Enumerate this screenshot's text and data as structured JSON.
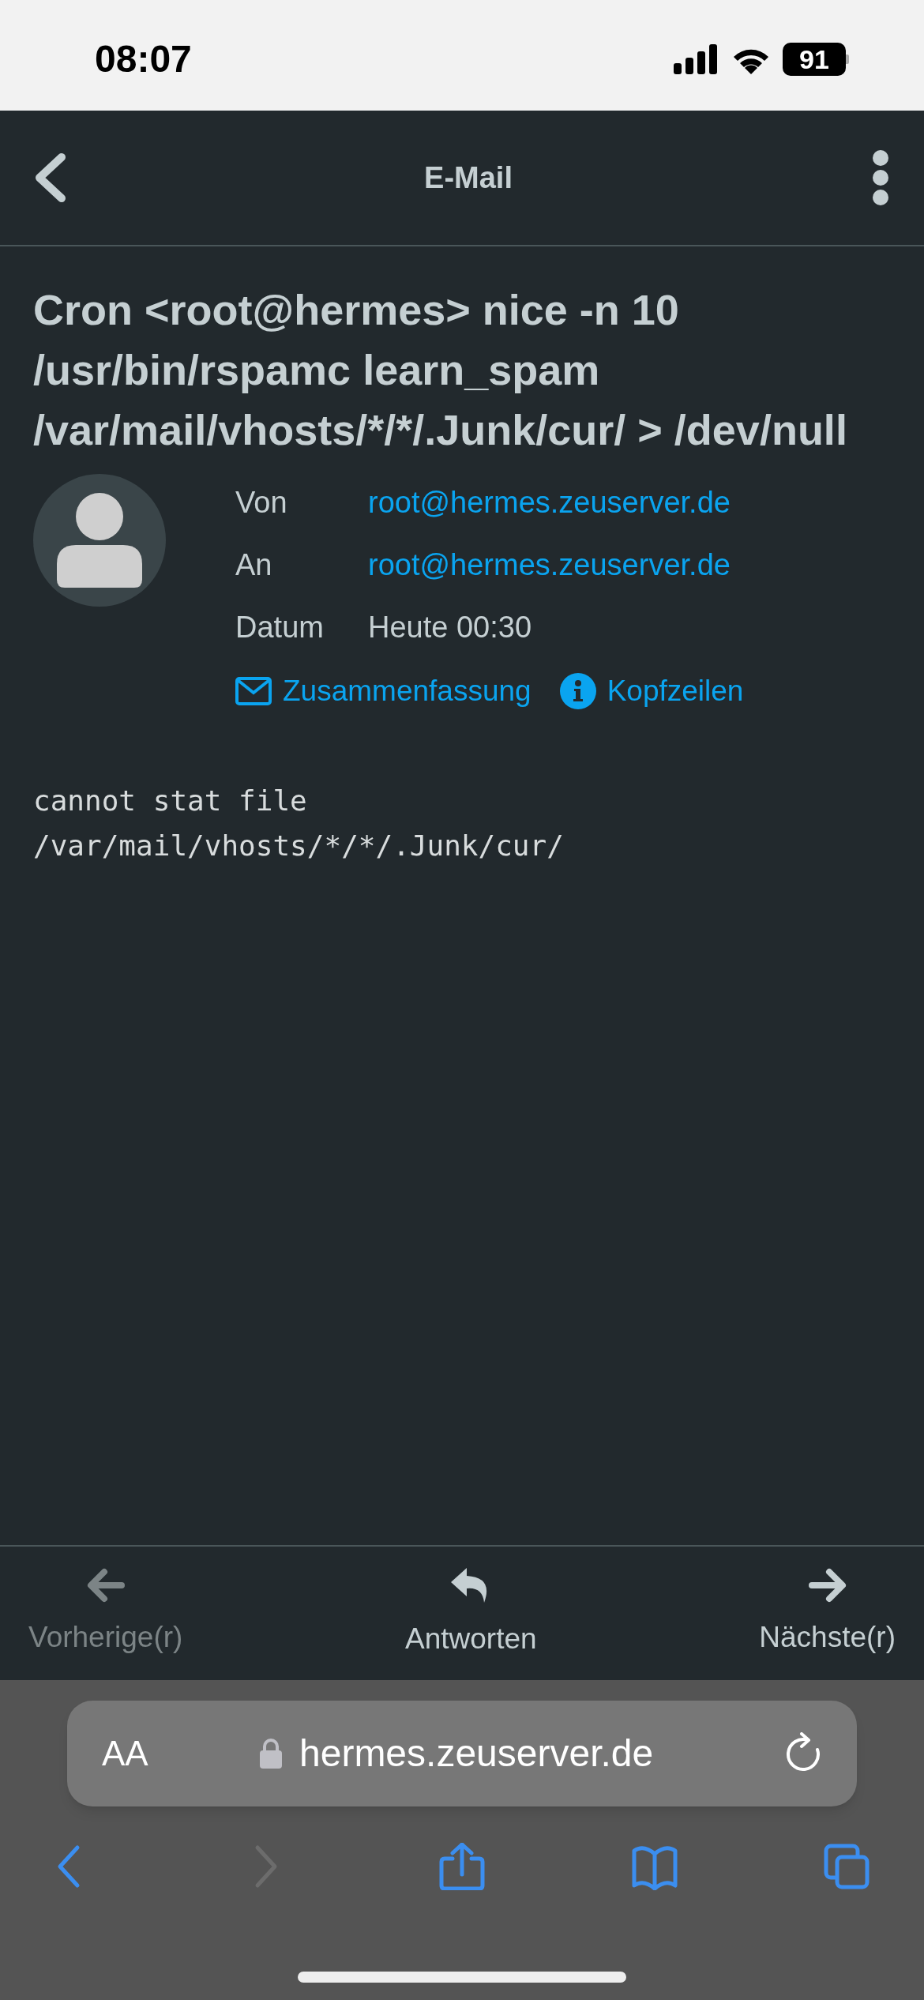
{
  "status_bar": {
    "time": "08:07",
    "battery": "91"
  },
  "header": {
    "title": "E-Mail"
  },
  "message": {
    "subject": "Cron <root@hermes> nice -n 10 /usr/bin/rspamc learn_spam /var/mail/vhosts/*/*/.Junk/cur/ > /dev/null",
    "fields": [
      {
        "label": "Von",
        "value": "root@hermes.zeuserver.de",
        "kind": "link"
      },
      {
        "label": "An",
        "value": "root@hermes.zeuserver.de",
        "kind": "link"
      },
      {
        "label": "Datum",
        "value": "Heute 00:30",
        "kind": "text"
      }
    ],
    "actions": [
      {
        "label": "Zusammenfassung",
        "kind": "summary"
      },
      {
        "label": "Kopfzeilen",
        "kind": "headers"
      }
    ],
    "body": "cannot stat file\n/var/mail/vhosts/*/*/.Junk/cur/"
  },
  "bottom_nav": [
    {
      "label": "Vorherige(r)",
      "kind": "previous",
      "disabled": true
    },
    {
      "label": "Antworten",
      "kind": "reply",
      "disabled": false
    },
    {
      "label": "Nächste(r)",
      "kind": "next",
      "disabled": false
    }
  ],
  "browser": {
    "text_size": "AA",
    "url": "hermes.zeuserver.de",
    "toolbar": [
      {
        "kind": "back",
        "disabled": false
      },
      {
        "kind": "forward",
        "disabled": true
      },
      {
        "kind": "share",
        "disabled": false
      },
      {
        "kind": "bookmarks",
        "disabled": false
      },
      {
        "kind": "tabs",
        "disabled": false
      }
    ]
  }
}
